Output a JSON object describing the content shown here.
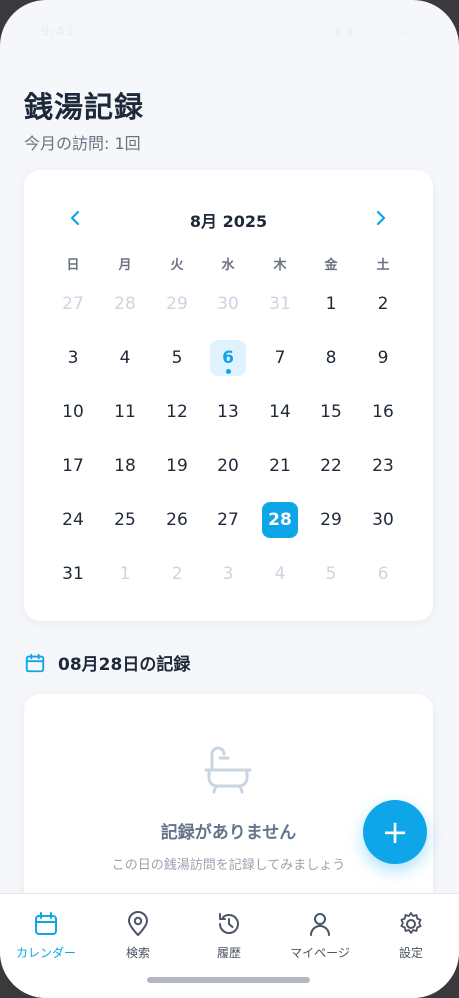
{
  "status_bar": {
    "time": "9:41",
    "icons": "▮▮ ◠ ▭"
  },
  "header": {
    "title": "銭湯記録",
    "subtitle": "今月の訪問: 1回"
  },
  "calendar": {
    "month_label": "8月 2025",
    "weekdays": [
      "日",
      "月",
      "火",
      "水",
      "木",
      "金",
      "土"
    ],
    "weeks": [
      [
        "27",
        "28",
        "29",
        "30",
        "31",
        "1",
        "2"
      ],
      [
        "3",
        "4",
        "5",
        "6",
        "7",
        "8",
        "9"
      ],
      [
        "10",
        "11",
        "12",
        "13",
        "14",
        "15",
        "16"
      ],
      [
        "17",
        "18",
        "19",
        "20",
        "21",
        "22",
        "23"
      ],
      [
        "24",
        "25",
        "26",
        "27",
        "28",
        "29",
        "30"
      ],
      [
        "31",
        "1",
        "2",
        "3",
        "4",
        "5",
        "6"
      ]
    ]
  },
  "record_section": {
    "title": "08月28日の記録"
  },
  "empty_state": {
    "title": "記録がありません",
    "subtitle": "この日の銭湯訪問を記録してみましょう"
  },
  "fab": {
    "label": "+"
  },
  "tabs": [
    {
      "label": "カレンダー",
      "icon": "calendar-icon"
    },
    {
      "label": "検索",
      "icon": "map-pin-icon"
    },
    {
      "label": "履歴",
      "icon": "history-icon"
    },
    {
      "label": "マイページ",
      "icon": "user-icon"
    },
    {
      "label": "設定",
      "icon": "gear-icon"
    }
  ],
  "colors": {
    "accent": "#0ea5e9",
    "today_bg": "#e0f2fe",
    "muted_day": "#cbd5e1"
  }
}
